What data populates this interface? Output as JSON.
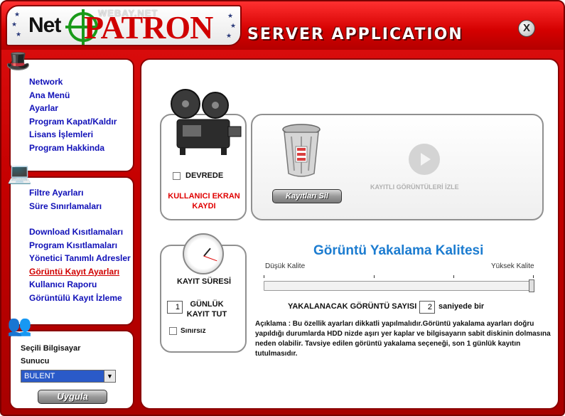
{
  "header": {
    "logo_net": "Net",
    "logo_patron": "PATRON",
    "logo_webay": "WEBAY.NET",
    "title": "SERVER APPLICATION",
    "close_label": "X"
  },
  "sidebar": {
    "group1": [
      {
        "label": "Network"
      },
      {
        "label": "Ana Menü"
      },
      {
        "label": "Ayarlar"
      },
      {
        "label": "Program Kapat/Kaldır"
      },
      {
        "label": "Lisans İşlemleri"
      },
      {
        "label": "Program Hakkinda"
      }
    ],
    "group2a": [
      {
        "label": "Filtre Ayarları"
      },
      {
        "label": "Süre Sınırlamaları"
      }
    ],
    "group2b": [
      {
        "label": "Download Kısıtlamaları"
      },
      {
        "label": "Program Kısıtlamaları"
      },
      {
        "label": "Yönetici Tanımlı Adresler"
      },
      {
        "label": "Görüntü Kayıt Ayarları",
        "active": true
      },
      {
        "label": "Kullanıcı Raporu"
      },
      {
        "label": "Görüntülü Kayıt İzleme"
      }
    ],
    "server": {
      "label_line1": "Seçili Bilgisayar",
      "label_line2": "Sunucu",
      "selected": "BULENT",
      "apply_label": "Uygula"
    }
  },
  "record": {
    "enabled_label": "DEVREDE",
    "enabled": false,
    "screen_record_label": "KULLANICI EKRAN KAYDI"
  },
  "playback": {
    "delete_label": "Kayıtları Sil",
    "watch_label": "KAYITLI GÖRÜNTÜLERİ İZLE"
  },
  "duration": {
    "title": "KAYIT SÜRESİ",
    "days_value": "1",
    "days_label": "GÜNLÜK KAYIT TUT",
    "unlimited_label": "Sınırsız",
    "unlimited": false
  },
  "quality": {
    "title": "Görüntü Yakalama Kalitesi",
    "low_label": "Düşük Kalite",
    "high_label": "Yüksek Kalite",
    "level": 1.0,
    "capture_count_label": "YAKALANACAK GÖRÜNTÜ SAYISI :",
    "capture_count_value": "2",
    "capture_unit": "saniyede bir",
    "description": "Açıklama : Bu özellik ayarları dikkatli yapılmalıdır.Görüntü yakalama ayarları doğru yapıldığı durumlarda HDD nizde aşırı yer kaplar ve bilgisayarın sabit diskinin dolmasına neden olabilir. Tavsiye edilen görüntü yakalama seçeneği, son 1 günlük kayıtın tutulmasıdır."
  },
  "colors": {
    "window_red": "#c40000",
    "nav_link": "#1010b8",
    "nav_active": "#d00000",
    "quality_title": "#1c7cd0"
  }
}
